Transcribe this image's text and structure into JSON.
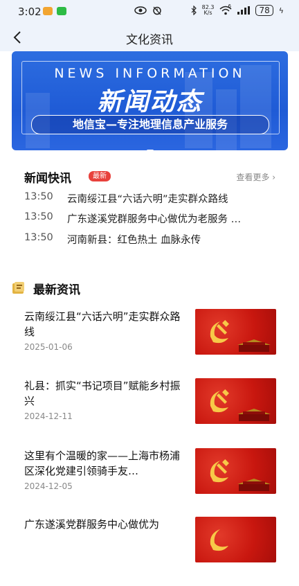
{
  "status": {
    "time": "3:02",
    "net_speed_value": "82.3",
    "net_speed_unit": "K/s",
    "battery": "78",
    "wifi_label": "6"
  },
  "nav": {
    "title": "文化资讯"
  },
  "banner": {
    "heading_en": "NEWS INFORMATION",
    "heading_cn": "新闻动态",
    "slogan": "地信宝—专注地理信息产业服务"
  },
  "flash": {
    "title": "新闻快讯",
    "badge": "最新",
    "more": "查看更多 ›",
    "items": [
      {
        "time": "13:50",
        "text": "云南绥江县“六话六明”走实群众路线"
      },
      {
        "time": "13:50",
        "text": "广东遂溪党群服务中心做优为老服务 …"
      },
      {
        "time": "13:50",
        "text": "河南新县：红色热土 血脉永传"
      }
    ]
  },
  "latest": {
    "title": "最新资讯",
    "items": [
      {
        "title": "云南绥江县“六话六明”走实群众路线",
        "date": "2025-01-06"
      },
      {
        "title": "礼县：抓实“书记项目”赋能乡村振兴",
        "date": "2024-12-11"
      },
      {
        "title": "这里有个温暖的家——上海市杨浦区深化党建引领骑手友…",
        "date": "2024-12-05"
      },
      {
        "title": "广东遂溪党群服务中心做优为",
        "date": ""
      }
    ]
  },
  "colors": {
    "accent_red": "#e8413c",
    "banner_blue": "#1f5bd6",
    "icon_gold": "#e3b341"
  },
  "icons": {
    "back": "chevron-left-icon",
    "doc": "document-icon",
    "eye": "eye-icon",
    "alarm": "alarm-icon",
    "bluetooth": "bluetooth-icon",
    "wifi": "wifi-icon",
    "signal": "signal-icon"
  }
}
